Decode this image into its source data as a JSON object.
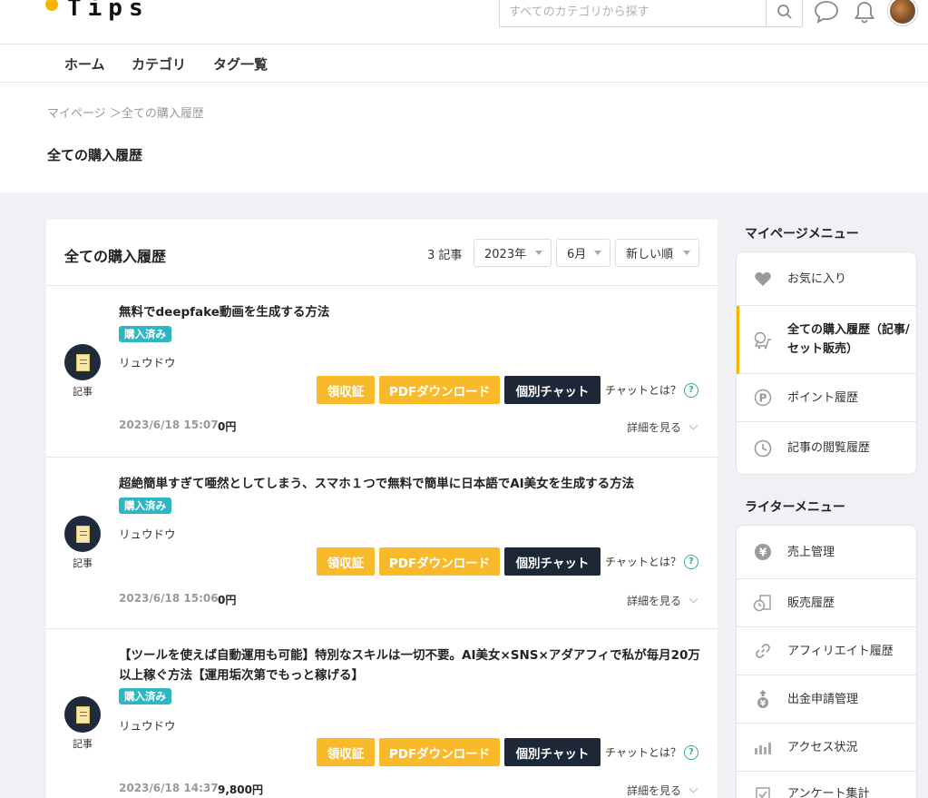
{
  "header": {
    "logo_text": "Tips",
    "search_placeholder": "すべてのカテゴリから探す"
  },
  "nav": [
    "ホーム",
    "カテゴリ",
    "タグ一覧"
  ],
  "breadcrumb": "マイページ ＞全ての購入履歴",
  "page_title": "全ての購入履歴",
  "list": {
    "title": "全ての購入履歴",
    "count": "3 記事",
    "year": "2023年",
    "month": "6月",
    "sort": "新しい順"
  },
  "labels": {
    "kind": "記事",
    "badge": "購入済み",
    "receipt": "領収証",
    "pdf": "PDFダウンロード",
    "chat": "個別チャット",
    "chat_q": "チャットとは？",
    "details": "詳細を見る"
  },
  "purchases": [
    {
      "title": "無料でdeepfake動画を生成する方法",
      "author": "リュウドウ",
      "date": "2023/6/18 15:07",
      "price": "0円"
    },
    {
      "title": "超絶簡単すぎて唖然としてしまう、スマホ１つで無料で簡単に日本語でAI美女を生成する方法",
      "author": "リュウドウ",
      "date": "2023/6/18 15:06",
      "price": "0円"
    },
    {
      "title": "【ツールを使えば自動運用も可能】特別なスキルは一切不要。AI美女×SNS×アダアフィで私が毎月20万以上稼ぐ方法【運用垢次第でもっと稼げる】",
      "author": "リュウドウ",
      "date": "2023/6/18 14:37",
      "price": "9,800円"
    }
  ],
  "sidebar": {
    "mypage_title": "マイページメニュー",
    "mypage_items": [
      {
        "label": "お気に入り",
        "icon": "heart-icon"
      },
      {
        "label": "全ての購入履歴（記事/セット販売）",
        "icon": "cart-icon"
      },
      {
        "label": "ポイント履歴",
        "icon": "point-icon"
      },
      {
        "label": "記事の閲覧履歴",
        "icon": "clock-icon"
      }
    ],
    "writer_title": "ライターメニュー",
    "writer_items": [
      {
        "label": "売上管理",
        "icon": "yen-icon"
      },
      {
        "label": "販売履歴",
        "icon": "sales-history-icon"
      },
      {
        "label": "アフィリエイト履歴",
        "icon": "link-icon"
      },
      {
        "label": "出金申請管理",
        "icon": "withdraw-icon"
      },
      {
        "label": "アクセス状況",
        "icon": "bar-chart-icon"
      },
      {
        "label": "アンケート集計",
        "icon": "check-icon"
      }
    ]
  },
  "colors": {
    "accent": "#f8b92a",
    "badge": "#2eb6c3",
    "dark_button": "#1c2738",
    "active_border": "#f7b500"
  }
}
